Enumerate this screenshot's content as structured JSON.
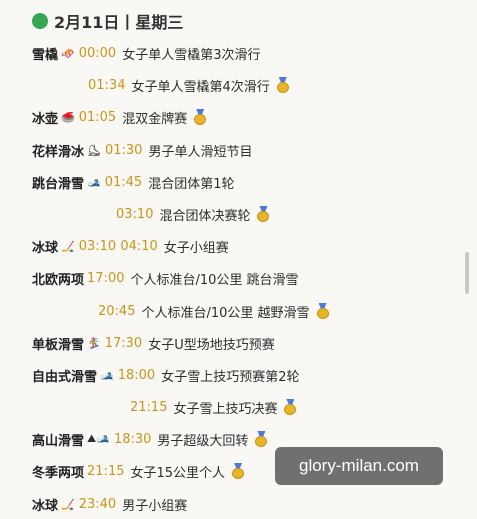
{
  "header": {
    "date_text": "2月11日丨星期三"
  },
  "rows": [
    {
      "sport": "雪橇",
      "emoji": "🛷",
      "time": "00:00",
      "event": "女子单人雪橇第3次滑行",
      "medal": false
    },
    {
      "sport": "",
      "emoji": "",
      "time": "01:34",
      "event": "女子单人雪橇第4次滑行",
      "medal": true
    },
    {
      "sport": "冰壶",
      "emoji": "🥌",
      "time": "01:05",
      "event": "混双金牌赛",
      "medal": true
    },
    {
      "sport": "花样滑冰",
      "emoji": "⛸",
      "time": "01:30",
      "event": "男子单人滑短节目",
      "medal": false
    },
    {
      "sport": "跳台滑雪",
      "emoji": "🎿",
      "time": "01:45",
      "event": "混合团体第1轮",
      "medal": false
    },
    {
      "sport": "",
      "emoji": "",
      "time": "03:10",
      "event": "混合团体决赛轮",
      "medal": true
    },
    {
      "sport": "冰球",
      "emoji": "🏒",
      "time": "03:10  04:10",
      "event": "女子小组赛",
      "medal": false
    },
    {
      "sport": "北欧两项",
      "emoji": "",
      "time": "17:00",
      "event": "个人标准台/10公里 跳台滑雪",
      "medal": false
    },
    {
      "sport": "",
      "emoji": "",
      "time": "20:45",
      "event": "个人标准台/10公里 越野滑雪",
      "medal": true
    },
    {
      "sport": "单板滑雪",
      "emoji": "🏂",
      "time": "17:30",
      "event": "女子U型场地技巧预赛",
      "medal": false
    },
    {
      "sport": "自由式滑雪",
      "emoji": "🎿",
      "time": "18:00",
      "event": "女子雪上技巧预赛第2轮",
      "medal": false
    },
    {
      "sport": "",
      "emoji": "",
      "time": "21:15",
      "event": "女子雪上技巧决赛",
      "medal": true
    },
    {
      "sport": "高山滑雪",
      "emoji": "⛰🎿",
      "time": "18:30",
      "event": "男子超级大回转",
      "medal": true
    },
    {
      "sport": "冬季两项",
      "emoji": "",
      "time": "21:15",
      "event": "女子15公里个人",
      "medal": true
    },
    {
      "sport": "冰球",
      "emoji": "🏒",
      "time": "23:40",
      "event": "男子小组赛",
      "medal": false
    }
  ],
  "watermark": "glory-milan.com"
}
